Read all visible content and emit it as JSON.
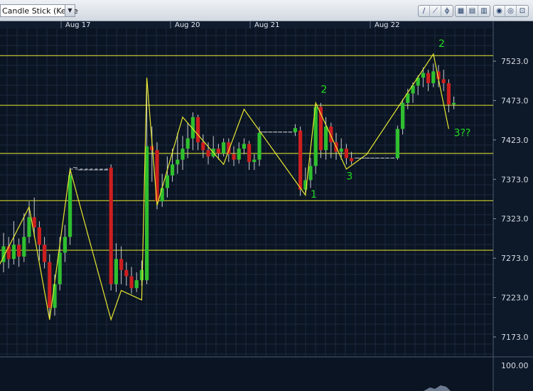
{
  "toolbar": {
    "chart_type": "Candle Stick (Kerze",
    "dropdown_icon": "chevron-down-icon",
    "tools": [
      {
        "name": "trendline-tool",
        "icon": "diagonal-line-icon",
        "glyph": "∕"
      },
      {
        "name": "ray-tool",
        "icon": "ray-icon",
        "glyph": "⟋"
      },
      {
        "name": "fibonacci-tool",
        "icon": "fibonacci-icon",
        "glyph": "ϕ"
      },
      {
        "name": "grid-tool",
        "icon": "grid-icon",
        "glyph": "▦"
      },
      {
        "name": "table-tool",
        "icon": "table-icon",
        "glyph": "▤"
      },
      {
        "name": "layout-tool",
        "icon": "layout-icon",
        "glyph": "▥"
      },
      {
        "name": "settings-tool",
        "icon": "settings-icon",
        "glyph": "◉"
      },
      {
        "name": "zoom-tool",
        "icon": "zoom-icon",
        "glyph": "◎"
      },
      {
        "name": "export-tool",
        "icon": "export-icon",
        "glyph": "⊡"
      }
    ]
  },
  "colors": {
    "background": "#0b1422",
    "grid": "#1b2a40",
    "up_candle": "#2fbf2f",
    "down_candle": "#cc1f1f",
    "wave_line": "#e8e830",
    "level_line": "#e8e830",
    "wave_label": "#22dd22"
  },
  "chart_data": {
    "type": "candlestick",
    "date_labels": [
      "Aug 17",
      "Aug 20",
      "Aug 21",
      "Aug 22"
    ],
    "ylim": [
      7150,
      7560
    ],
    "y_ticks": [
      "7523.0",
      "7473.0",
      "7423.0",
      "7373.0",
      "7323.0",
      "7273.0",
      "7223.0",
      "7173.0"
    ],
    "lower_panel_tick": "100.00",
    "horizontal_levels": [
      7530,
      7467,
      7406,
      7346,
      7283
    ],
    "grid": true,
    "candles": [
      [
        7268,
        7288,
        7305,
        7255
      ],
      [
        7288,
        7272,
        7300,
        7260
      ],
      [
        7272,
        7290,
        7320,
        7265
      ],
      [
        7290,
        7275,
        7298,
        7262
      ],
      [
        7275,
        7300,
        7330,
        7268
      ],
      [
        7300,
        7325,
        7345,
        7292
      ],
      [
        7325,
        7312,
        7350,
        7300
      ],
      [
        7312,
        7290,
        7320,
        7270
      ],
      [
        7290,
        7268,
        7300,
        7260
      ],
      [
        7268,
        7210,
        7278,
        7195
      ],
      [
        7210,
        7240,
        7252,
        7200
      ],
      [
        7240,
        7280,
        7300,
        7232
      ],
      [
        7280,
        7300,
        7315,
        7268
      ],
      [
        7300,
        7378,
        7388,
        7290
      ],
      [
        7380,
        7388,
        7392,
        7372
      ],
      [
        7385,
        7385,
        7387,
        7383
      ],
      [
        7385,
        7385,
        7387,
        7383
      ],
      [
        7385,
        7385,
        7387,
        7383
      ],
      [
        7385,
        7385,
        7387,
        7383
      ],
      [
        7385,
        7385,
        7387,
        7383
      ],
      [
        7385,
        7385,
        7387,
        7383
      ],
      [
        7388,
        7240,
        7392,
        7232
      ],
      [
        7240,
        7272,
        7292,
        7230
      ],
      [
        7272,
        7258,
        7288,
        7240
      ],
      [
        7258,
        7250,
        7268,
        7238
      ],
      [
        7250,
        7235,
        7262,
        7228
      ],
      [
        7235,
        7245,
        7255,
        7230
      ],
      [
        7245,
        7258,
        7270,
        7238
      ],
      [
        7245,
        7415,
        7500,
        7240
      ],
      [
        7415,
        7410,
        7440,
        7370
      ],
      [
        7410,
        7345,
        7420,
        7335
      ],
      [
        7345,
        7362,
        7380,
        7338
      ],
      [
        7362,
        7378,
        7402,
        7350
      ],
      [
        7378,
        7392,
        7412,
        7370
      ],
      [
        7392,
        7398,
        7432,
        7380
      ],
      [
        7398,
        7412,
        7428,
        7385
      ],
      [
        7412,
        7425,
        7445,
        7400
      ],
      [
        7425,
        7452,
        7458,
        7410
      ],
      [
        7452,
        7420,
        7455,
        7410
      ],
      [
        7420,
        7410,
        7430,
        7400
      ],
      [
        7410,
        7402,
        7420,
        7392
      ],
      [
        7402,
        7412,
        7428,
        7400
      ],
      [
        7412,
        7406,
        7418,
        7398
      ],
      [
        7406,
        7420,
        7425,
        7402
      ],
      [
        7420,
        7405,
        7425,
        7395
      ],
      [
        7405,
        7398,
        7415,
        7390
      ],
      [
        7398,
        7412,
        7420,
        7393
      ],
      [
        7412,
        7418,
        7425,
        7405
      ],
      [
        7418,
        7395,
        7422,
        7385
      ],
      [
        7395,
        7398,
        7405,
        7385
      ],
      [
        7398,
        7432,
        7440,
        7390
      ],
      [
        7433,
        7433,
        7435,
        7431
      ],
      [
        7433,
        7433,
        7435,
        7431
      ],
      [
        7433,
        7433,
        7435,
        7431
      ],
      [
        7433,
        7433,
        7435,
        7431
      ],
      [
        7433,
        7433,
        7435,
        7431
      ],
      [
        7433,
        7433,
        7435,
        7431
      ],
      [
        7433,
        7438,
        7443,
        7428
      ],
      [
        7435,
        7360,
        7440,
        7352
      ],
      [
        7360,
        7372,
        7388,
        7355
      ],
      [
        7372,
        7390,
        7400,
        7362
      ],
      [
        7390,
        7465,
        7470,
        7380
      ],
      [
        7465,
        7410,
        7470,
        7400
      ],
      [
        7410,
        7440,
        7452,
        7398
      ],
      [
        7440,
        7420,
        7445,
        7400
      ],
      [
        7420,
        7408,
        7432,
        7398
      ],
      [
        7408,
        7412,
        7425,
        7398
      ],
      [
        7412,
        7400,
        7418,
        7392
      ],
      [
        7400,
        7396,
        7408,
        7392
      ],
      [
        7396,
        7400,
        7404,
        7394
      ],
      [
        7400,
        7400,
        7402,
        7398
      ],
      [
        7400,
        7400,
        7402,
        7398
      ],
      [
        7400,
        7400,
        7402,
        7398
      ],
      [
        7400,
        7400,
        7402,
        7398
      ],
      [
        7400,
        7400,
        7402,
        7398
      ],
      [
        7400,
        7400,
        7402,
        7398
      ],
      [
        7400,
        7400,
        7402,
        7398
      ],
      [
        7400,
        7437,
        7441,
        7398
      ],
      [
        7437,
        7470,
        7475,
        7430
      ],
      [
        7470,
        7482,
        7488,
        7462
      ],
      [
        7482,
        7492,
        7496,
        7470
      ],
      [
        7492,
        7502,
        7505,
        7480
      ],
      [
        7502,
        7508,
        7515,
        7490
      ],
      [
        7508,
        7495,
        7512,
        7485
      ],
      [
        7495,
        7510,
        7520,
        7490
      ],
      [
        7510,
        7500,
        7518,
        7490
      ],
      [
        7500,
        7495,
        7512,
        7485
      ],
      [
        7495,
        7468,
        7500,
        7458
      ],
      [
        7468,
        7470,
        7478,
        7462
      ]
    ],
    "gap_indices": [
      14,
      15,
      16,
      17,
      18,
      19,
      20,
      51,
      52,
      53,
      54,
      55,
      56,
      69,
      70,
      71,
      72,
      73,
      74,
      75,
      76
    ],
    "wave_path": [
      [
        -1,
        7262
      ],
      [
        5,
        7338
      ],
      [
        9,
        7195
      ],
      [
        13,
        7386
      ],
      [
        21,
        7195
      ],
      [
        23,
        7232
      ],
      [
        27,
        7220
      ],
      [
        28,
        7502
      ],
      [
        30,
        7340
      ],
      [
        35,
        7452
      ],
      [
        43,
        7392
      ],
      [
        47,
        7462
      ],
      [
        59,
        7353
      ],
      [
        61,
        7470
      ],
      [
        67,
        7386
      ],
      [
        71,
        7405
      ],
      [
        84,
        7532
      ],
      [
        87,
        7437
      ]
    ],
    "dashed_levels": [
      {
        "from": 13,
        "to": 21,
        "value": 7386
      },
      {
        "from": 50,
        "to": 57,
        "value": 7433
      },
      {
        "from": 69,
        "to": 77,
        "value": 7400
      }
    ],
    "wave_labels": [
      {
        "text": "2",
        "index": 62,
        "value": 7483
      },
      {
        "text": "1",
        "index": 60,
        "value": 7350
      },
      {
        "text": "3",
        "index": 67,
        "value": 7373
      },
      {
        "text": "2",
        "index": 85,
        "value": 7541
      },
      {
        "text": "3??",
        "index": 88,
        "value": 7428
      }
    ]
  }
}
